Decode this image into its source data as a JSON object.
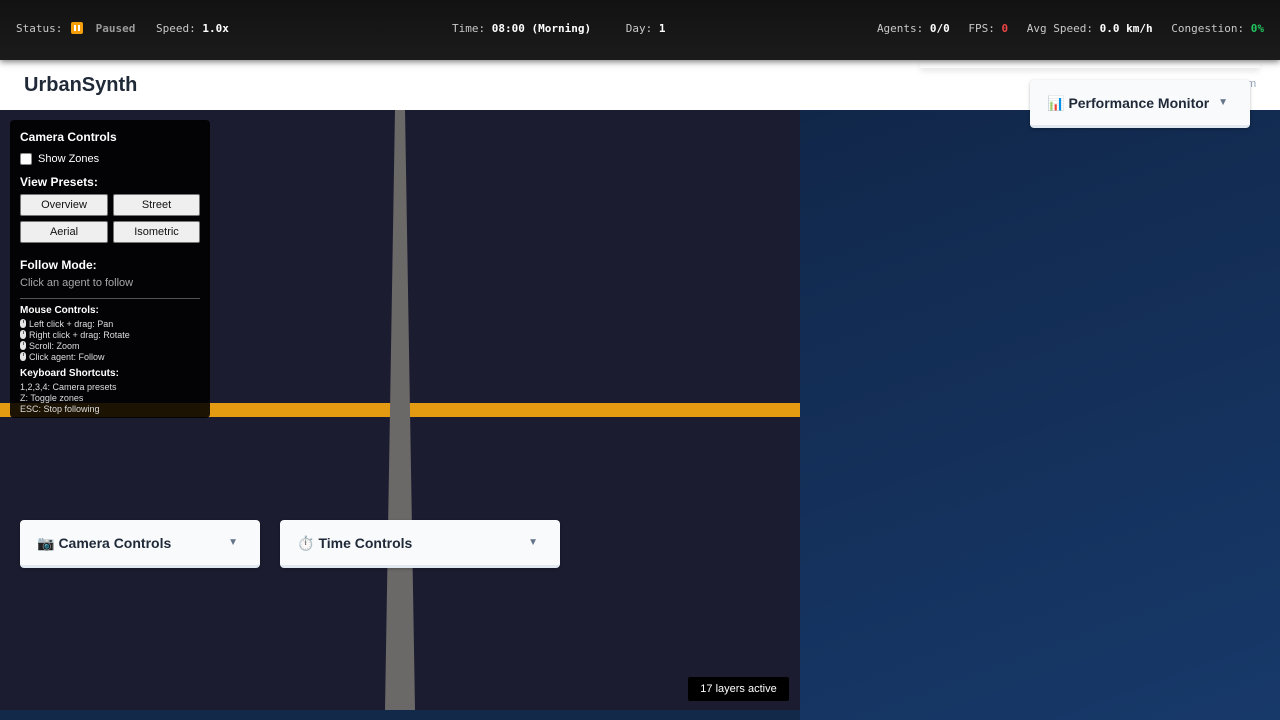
{
  "statusbar": {
    "status_label": "Status:",
    "status_value": "Paused",
    "speed_label": "Speed:",
    "speed_value": "1.0x",
    "time_label": "Time:",
    "time_value": "08:00 (Morning)",
    "day_label": "Day:",
    "day_value": "1",
    "agents_label": "Agents:",
    "agents_value": "0/0",
    "fps_label": "FPS:",
    "fps_value": "0",
    "avgspeed_label": "Avg Speed:",
    "avgspeed_value": "0.0 km/h",
    "congestion_label": "Congestion:",
    "congestion_value": "0%"
  },
  "header": {
    "title": "UrbanSynth",
    "fragment": "m"
  },
  "camera_panel": {
    "title": "Camera Controls",
    "show_zones": "Show Zones",
    "show_zones_checked": false,
    "view_presets_label": "View Presets:",
    "presets": [
      "Overview",
      "Street",
      "Aerial",
      "Isometric"
    ],
    "follow_label": "Follow Mode:",
    "follow_hint": "Click an agent to follow",
    "mouse_label": "Mouse Controls:",
    "mouse_items": [
      "Left click + drag: Pan",
      "Right click + drag: Rotate",
      "Scroll: Zoom",
      "Click agent: Follow"
    ],
    "keyboard_label": "Keyboard Shortcuts:",
    "keyboard_items": [
      "1,2,3,4: Camera presets",
      "Z: Toggle zones",
      "ESC: Stop following"
    ]
  },
  "cards": {
    "camera": "Camera Controls",
    "time": "Time Controls",
    "performance": "Performance Monitor"
  },
  "icons": {
    "camera": "camera-icon",
    "time": "stopwatch-icon",
    "performance": "bar-chart-icon",
    "chevron": "chevron-down-icon"
  },
  "layers_badge": "17 layers active",
  "colors": {
    "road_main": "#e49b12",
    "status_paused": "#f59e0b",
    "fps": "#ef4444",
    "congestion": "#22c55e"
  }
}
